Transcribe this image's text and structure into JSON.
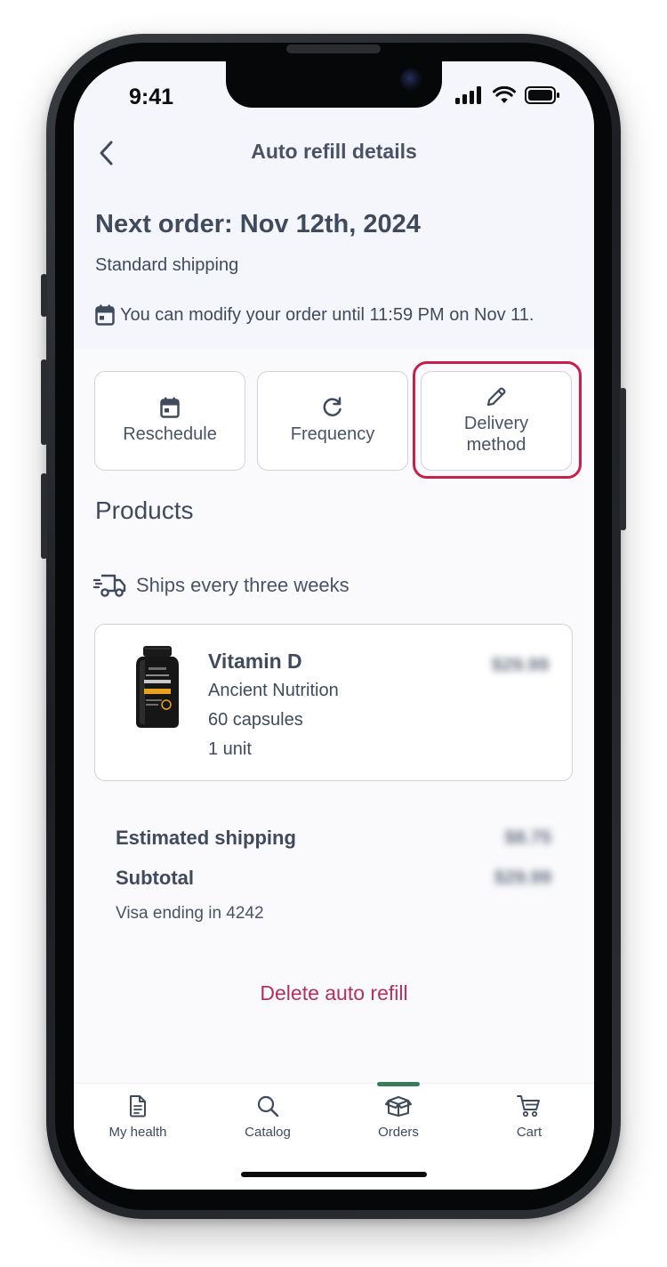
{
  "status_bar": {
    "time": "9:41"
  },
  "header": {
    "title": "Auto refill details",
    "next_order": "Next order: Nov 12th, 2024",
    "shipping_type": "Standard shipping",
    "modify_note": "You can modify your order until 11:59 PM on Nov 11."
  },
  "actions": {
    "reschedule": "Reschedule",
    "frequency": "Frequency",
    "delivery_line1": "Delivery",
    "delivery_line2": "method"
  },
  "products": {
    "heading": "Products",
    "ships_text": "Ships every three weeks",
    "items": [
      {
        "name": "Vitamin D",
        "brand": "Ancient Nutrition",
        "size": "60 capsules",
        "quantity": "1 unit",
        "price": "$29.99"
      }
    ]
  },
  "summary": {
    "shipping_label": "Estimated shipping",
    "shipping_value": "$8.75",
    "subtotal_label": "Subtotal",
    "subtotal_value": "$29.99",
    "payment": "Visa ending in 4242"
  },
  "delete_label": "Delete auto refill",
  "tabs": [
    {
      "label": "My health",
      "icon": "document-icon"
    },
    {
      "label": "Catalog",
      "icon": "search-icon"
    },
    {
      "label": "Orders",
      "icon": "box-icon",
      "active": true
    },
    {
      "label": "Cart",
      "icon": "cart-icon"
    }
  ],
  "colors": {
    "accent": "#c8204a",
    "delete": "#b3305f",
    "active_tab": "#3b7a5a",
    "hero_bg": "#f4f6fb"
  }
}
